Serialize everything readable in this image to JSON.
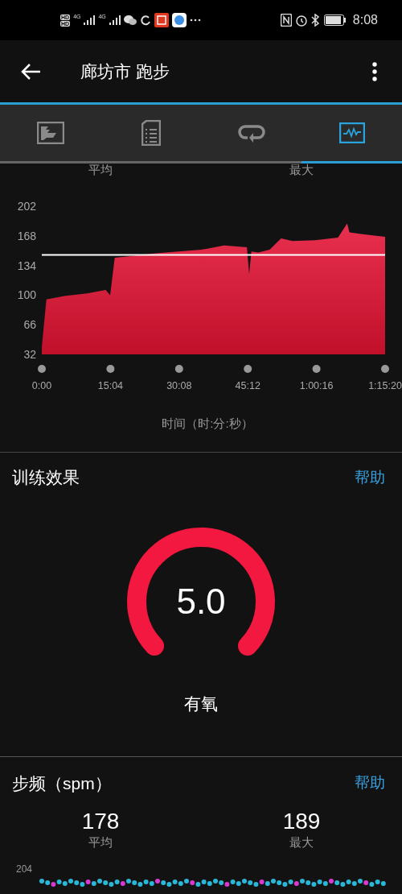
{
  "status_bar": {
    "sim_badges": [
      "HD",
      "HD"
    ],
    "networks": [
      "4G",
      "4G"
    ],
    "time": "8:08"
  },
  "app_bar": {
    "title": "廊坊市 跑步"
  },
  "tabs": [
    {
      "kind": "map",
      "selected": false
    },
    {
      "kind": "details",
      "selected": false
    },
    {
      "kind": "laps",
      "selected": false
    },
    {
      "kind": "charts",
      "selected": true
    }
  ],
  "heart_rate": {
    "stat_labels": [
      "平均",
      "最大"
    ],
    "chart_data": {
      "type": "area",
      "xlabel": "时间（时:分:秒）",
      "x": [
        0,
        60,
        300,
        600,
        840,
        900,
        960,
        1200,
        1500,
        1800,
        2100,
        2400,
        2700,
        2730,
        2760,
        2850,
        3000,
        3150,
        3300,
        3600,
        3900,
        4020,
        4050,
        4200,
        4400,
        4520
      ],
      "series": [
        {
          "color": "#e8304f",
          "values": [
            40,
            95,
            99,
            102,
            106,
            100,
            143,
            145,
            148,
            150,
            152,
            157,
            155,
            124,
            150,
            149,
            152,
            165,
            162,
            163,
            166,
            182,
            172,
            170,
            168,
            167
          ]
        }
      ],
      "xlim": [
        0,
        4520
      ],
      "ylim": [
        32,
        202
      ],
      "yticks": [
        32,
        66,
        100,
        134,
        168,
        202
      ],
      "xticks": [
        {
          "value": 0,
          "label": "0:00"
        },
        {
          "value": 904,
          "label": "15:04"
        },
        {
          "value": 1808,
          "label": "30:08"
        },
        {
          "value": 2712,
          "label": "45:12"
        },
        {
          "value": 3616,
          "label": "1:00:16"
        },
        {
          "value": 4520,
          "label": "1:15:20"
        }
      ],
      "ref_lines": [
        {
          "axis": "y",
          "value": 146
        }
      ]
    }
  },
  "training_effect": {
    "title": "训练效果",
    "help": "帮助",
    "value": "5.0",
    "label": "有氧"
  },
  "cadence": {
    "title": "步频（spm）",
    "help": "帮助",
    "stats": [
      {
        "value": "178",
        "label": "平均"
      },
      {
        "value": "189",
        "label": "最大"
      }
    ],
    "ytick": "204"
  }
}
